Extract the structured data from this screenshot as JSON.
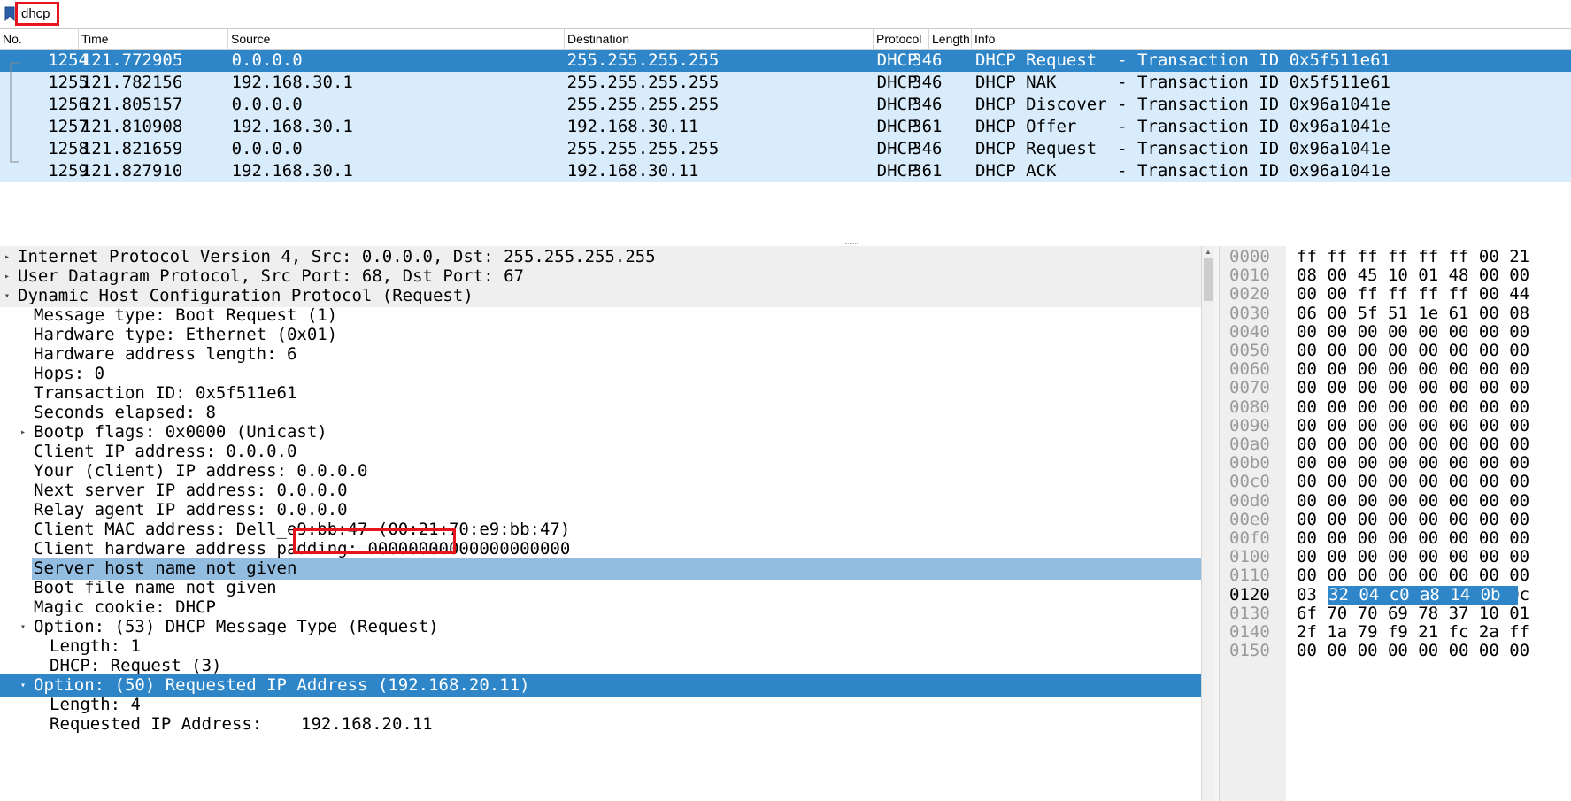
{
  "filter": {
    "value": "dhcp",
    "bookmark_icon": "bookmark-icon"
  },
  "packet_list": {
    "columns": [
      "No.",
      "Time",
      "Source",
      "Destination",
      "Protocol",
      "Length",
      "Info"
    ],
    "rows": [
      {
        "no": "1254",
        "time": "121.772905",
        "src": "0.0.0.0",
        "dst": "255.255.255.255",
        "proto": "DHCP",
        "len": "346",
        "info": "DHCP Request  - Transaction ID 0x5f511e61"
      },
      {
        "no": "1255",
        "time": "121.782156",
        "src": "192.168.30.1",
        "dst": "255.255.255.255",
        "proto": "DHCP",
        "len": "346",
        "info": "DHCP NAK      - Transaction ID 0x5f511e61"
      },
      {
        "no": "1256",
        "time": "121.805157",
        "src": "0.0.0.0",
        "dst": "255.255.255.255",
        "proto": "DHCP",
        "len": "346",
        "info": "DHCP Discover - Transaction ID 0x96a1041e"
      },
      {
        "no": "1257",
        "time": "121.810908",
        "src": "192.168.30.1",
        "dst": "192.168.30.11",
        "proto": "DHCP",
        "len": "361",
        "info": "DHCP Offer    - Transaction ID 0x96a1041e"
      },
      {
        "no": "1258",
        "time": "121.821659",
        "src": "0.0.0.0",
        "dst": "255.255.255.255",
        "proto": "DHCP",
        "len": "346",
        "info": "DHCP Request  - Transaction ID 0x96a1041e"
      },
      {
        "no": "1259",
        "time": "121.827910",
        "src": "192.168.30.1",
        "dst": "192.168.30.11",
        "proto": "DHCP",
        "len": "361",
        "info": "DHCP ACK      - Transaction ID 0x96a1041e"
      }
    ],
    "selected_row_color": "#2e86c9",
    "row_color": "#d9ecfc"
  },
  "details": {
    "rows": [
      {
        "text": "Internet Protocol Version 4, Src: 0.0.0.0, Dst: 255.255.255.255",
        "toggle": "▸"
      },
      {
        "text": "User Datagram Protocol, Src Port: 68, Dst Port: 67",
        "toggle": "▸"
      },
      {
        "text": "Dynamic Host Configuration Protocol (Request)",
        "toggle": "▾"
      },
      {
        "text": "Message type: Boot Request (1)",
        "toggle": ""
      },
      {
        "text": "Hardware type: Ethernet (0x01)",
        "toggle": ""
      },
      {
        "text": "Hardware address length: 6",
        "toggle": ""
      },
      {
        "text": "Hops: 0",
        "toggle": ""
      },
      {
        "text": "Transaction ID: 0x5f511e61",
        "toggle": ""
      },
      {
        "text": "Seconds elapsed: 8",
        "toggle": ""
      },
      {
        "text": "Bootp flags: 0x0000 (Unicast)",
        "toggle": "▸"
      },
      {
        "text": "Client IP address: 0.0.0.0",
        "toggle": ""
      },
      {
        "text": "Your (client) IP address: 0.0.0.0",
        "toggle": ""
      },
      {
        "text": "Next server IP address: 0.0.0.0",
        "toggle": ""
      },
      {
        "text": "Relay agent IP address: 0.0.0.0",
        "toggle": ""
      },
      {
        "text": "Client MAC address: Dell_e9:bb:47 (00:21:70:e9:bb:47)",
        "toggle": ""
      },
      {
        "text": "Client hardware address padding: 00000000000000000000",
        "toggle": ""
      },
      {
        "text": "Server host name not given",
        "toggle": ""
      },
      {
        "text": "Boot file name not given",
        "toggle": ""
      },
      {
        "text": "Magic cookie: DHCP",
        "toggle": ""
      },
      {
        "text": "Option: (53) DHCP Message Type (Request)",
        "toggle": "▾"
      },
      {
        "text": "Length: 1",
        "toggle": ""
      },
      {
        "text": "DHCP: Request (3)",
        "toggle": ""
      },
      {
        "text": "Option: (50) Requested IP Address (192.168.20.11)",
        "toggle": "▾"
      },
      {
        "text": "Length: 4",
        "toggle": ""
      },
      {
        "text": "Requested IP Address: ",
        "toggle": ""
      }
    ],
    "requested_ip": "192.168.20.11"
  },
  "bytes": {
    "rows": [
      {
        "off": "0000",
        "hex": "ff ff ff ff ff ff 00 21"
      },
      {
        "off": "0010",
        "hex": "08 00 45 10 01 48 00 00"
      },
      {
        "off": "0020",
        "hex": "00 00 ff ff ff ff 00 44"
      },
      {
        "off": "0030",
        "hex": "06 00 5f 51 1e 61 00 08"
      },
      {
        "off": "0040",
        "hex": "00 00 00 00 00 00 00 00"
      },
      {
        "off": "0050",
        "hex": "00 00 00 00 00 00 00 00"
      },
      {
        "off": "0060",
        "hex": "00 00 00 00 00 00 00 00"
      },
      {
        "off": "0070",
        "hex": "00 00 00 00 00 00 00 00"
      },
      {
        "off": "0080",
        "hex": "00 00 00 00 00 00 00 00"
      },
      {
        "off": "0090",
        "hex": "00 00 00 00 00 00 00 00"
      },
      {
        "off": "00a0",
        "hex": "00 00 00 00 00 00 00 00"
      },
      {
        "off": "00b0",
        "hex": "00 00 00 00 00 00 00 00"
      },
      {
        "off": "00c0",
        "hex": "00 00 00 00 00 00 00 00"
      },
      {
        "off": "00d0",
        "hex": "00 00 00 00 00 00 00 00"
      },
      {
        "off": "00e0",
        "hex": "00 00 00 00 00 00 00 00"
      },
      {
        "off": "00f0",
        "hex": "00 00 00 00 00 00 00 00"
      },
      {
        "off": "0100",
        "hex": "00 00 00 00 00 00 00 00"
      },
      {
        "off": "0110",
        "hex": "00 00 00 00 00 00 00 00"
      },
      {
        "off": "0120",
        "hex": "03 32 04 c0 a8 14 0b 0c"
      },
      {
        "off": "0130",
        "hex": "6f 70 70 69 78 37 10 01"
      },
      {
        "off": "0140",
        "hex": "2f 1a 79 f9 21 fc 2a ff"
      },
      {
        "off": "0150",
        "hex": "00 00 00 00 00 00 00 00"
      }
    ],
    "highlight_hex": "32 04 c0 a8 14 0b"
  }
}
